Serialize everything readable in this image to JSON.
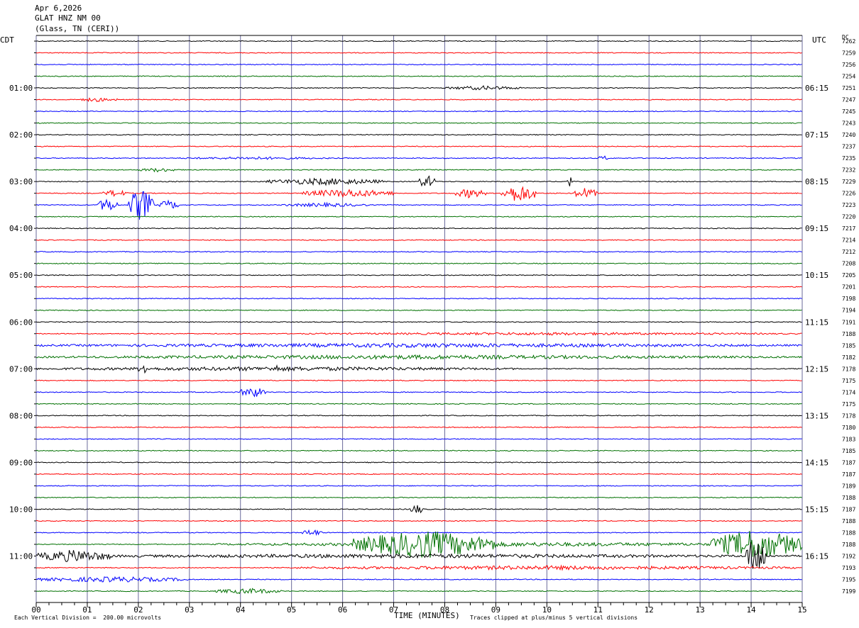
{
  "header": {
    "date": "Apr 6,2026",
    "station": "GLAT HNZ NM 00",
    "location": "(Glass, TN (CERI))"
  },
  "left_axis_label": "CDT",
  "right_axis_label": "UTC",
  "dc_label": "DC",
  "footer": {
    "scale": "Each Vertical Division =  200.00 microvolts",
    "xlabel": "TIME (MINUTES)",
    "clip": "Traces clipped at plus/minus 5 vertical divisions"
  },
  "chart_data": {
    "type": "line",
    "title": "",
    "xlabel": "TIME (MINUTES)",
    "xlim": [
      0,
      15
    ],
    "x_ticks": [
      "00",
      "01",
      "02",
      "03",
      "04",
      "05",
      "06",
      "07",
      "08",
      "09",
      "10",
      "11",
      "12",
      "13",
      "14",
      "15"
    ],
    "trace_colors": [
      "#000000",
      "#ff0000",
      "#0000ff",
      "#007000"
    ],
    "left_time_labels": [
      "01:00",
      "02:00",
      "03:00",
      "04:00",
      "05:00",
      "06:00",
      "07:00",
      "08:00",
      "09:00",
      "10:00",
      "11:00"
    ],
    "right_time_labels": [
      "06:15",
      "07:15",
      "08:15",
      "09:15",
      "10:15",
      "11:15",
      "12:15",
      "13:15",
      "14:15",
      "15:15",
      "16:15"
    ],
    "dc_offsets": [
      7262,
      7259,
      7256,
      7254,
      7251,
      7247,
      7245,
      7243,
      7240,
      7237,
      7235,
      7232,
      7229,
      7226,
      7223,
      7220,
      7217,
      7214,
      7212,
      7208,
      7205,
      7201,
      7198,
      7194,
      7191,
      7188,
      7185,
      7182,
      7178,
      7175,
      7174,
      7175,
      7178,
      7180,
      7183,
      7185,
      7187,
      7187,
      7189,
      7188,
      7187,
      7188,
      7188,
      7188,
      7192,
      7193,
      7195,
      7199
    ],
    "events": [
      {
        "trace": 4,
        "start": 8.0,
        "end": 9.5,
        "amp": 3
      },
      {
        "trace": 5,
        "start": 0.8,
        "end": 1.6,
        "amp": 3
      },
      {
        "trace": 10,
        "start": 2.8,
        "end": 5.8,
        "amp": 2
      },
      {
        "trace": 10,
        "start": 11.0,
        "end": 11.2,
        "amp": 4
      },
      {
        "trace": 11,
        "start": 2.0,
        "end": 2.8,
        "amp": 3
      },
      {
        "trace": 12,
        "start": 4.5,
        "end": 6.8,
        "amp": 5
      },
      {
        "trace": 12,
        "start": 7.5,
        "end": 7.8,
        "amp": 10
      },
      {
        "trace": 12,
        "start": 10.4,
        "end": 10.5,
        "amp": 9
      },
      {
        "trace": 13,
        "start": 1.3,
        "end": 1.8,
        "amp": 5
      },
      {
        "trace": 13,
        "start": 5.2,
        "end": 7.0,
        "amp": 6
      },
      {
        "trace": 13,
        "start": 8.2,
        "end": 8.8,
        "amp": 7
      },
      {
        "trace": 13,
        "start": 9.1,
        "end": 9.8,
        "amp": 13
      },
      {
        "trace": 13,
        "start": 10.5,
        "end": 11.0,
        "amp": 8
      },
      {
        "trace": 14,
        "start": 1.2,
        "end": 1.6,
        "amp": 10
      },
      {
        "trace": 14,
        "start": 1.8,
        "end": 2.3,
        "amp": 24
      },
      {
        "trace": 14,
        "start": 2.4,
        "end": 2.8,
        "amp": 7
      },
      {
        "trace": 14,
        "start": 4.8,
        "end": 6.5,
        "amp": 3
      },
      {
        "trace": 25,
        "start": 5.2,
        "end": 15.0,
        "amp": 2
      },
      {
        "trace": 26,
        "start": 0.0,
        "end": 15.0,
        "amp": 3
      },
      {
        "trace": 27,
        "start": 0.0,
        "end": 15.0,
        "amp": 3
      },
      {
        "trace": 28,
        "start": 0.0,
        "end": 9.5,
        "amp": 3
      },
      {
        "trace": 28,
        "start": 2.0,
        "end": 2.2,
        "amp": 9
      },
      {
        "trace": 28,
        "start": 4.6,
        "end": 4.8,
        "amp": 6
      },
      {
        "trace": 30,
        "start": 4.0,
        "end": 4.5,
        "amp": 8
      },
      {
        "trace": 40,
        "start": 7.3,
        "end": 7.6,
        "amp": 7
      },
      {
        "trace": 42,
        "start": 5.2,
        "end": 5.6,
        "amp": 5
      },
      {
        "trace": 43,
        "start": 3.5,
        "end": 15.0,
        "amp": 3
      },
      {
        "trace": 43,
        "start": 6.2,
        "end": 9.0,
        "amp": 20
      },
      {
        "trace": 43,
        "start": 13.2,
        "end": 15.0,
        "amp": 22
      },
      {
        "trace": 44,
        "start": 0.0,
        "end": 1.5,
        "amp": 9
      },
      {
        "trace": 44,
        "start": 0.0,
        "end": 15.0,
        "amp": 3
      },
      {
        "trace": 45,
        "start": 5.0,
        "end": 15.0,
        "amp": 3
      },
      {
        "trace": 46,
        "start": 0.0,
        "end": 3.0,
        "amp": 4
      },
      {
        "trace": 47,
        "start": 3.5,
        "end": 4.8,
        "amp": 4
      },
      {
        "trace": 44,
        "start": 13.9,
        "end": 14.3,
        "amp": 30
      }
    ]
  }
}
